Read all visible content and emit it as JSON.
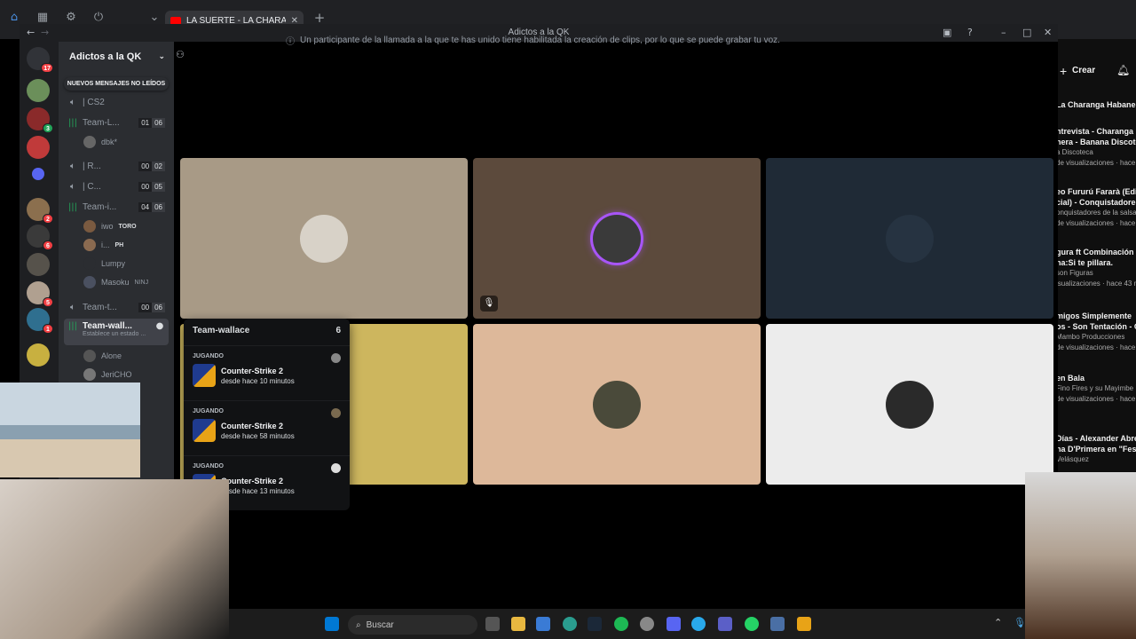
{
  "browser": {
    "tab_title": "LA SUERTE - LA CHARANGA H",
    "tab_close": "✕",
    "new_tab": "+"
  },
  "discord": {
    "window_title": "Adictos a la QK",
    "notice": "Un participante de la llamada a la que te has unido tiene habilitada la creación de clips, por lo que se puede grabar tu voz.",
    "home_badge": "17",
    "server_badges": [
      "3",
      "2",
      "6",
      "5",
      "1"
    ],
    "guild_name": "Adictos a la QK",
    "new_messages": "NUEVOS MENSAJES NO LEÍDOS",
    "channels": [
      {
        "name": "| CS2",
        "a": "",
        "b": ""
      },
      {
        "name": "Team-L...",
        "a": "01",
        "b": "06"
      },
      {
        "name": "| R...",
        "a": "00",
        "b": "02"
      },
      {
        "name": "| C...",
        "a": "00",
        "b": "05"
      },
      {
        "name": "Team-i...",
        "a": "04",
        "b": "06"
      },
      {
        "name": "Team-t...",
        "a": "00",
        "b": "06"
      },
      {
        "name": "Team-wall...",
        "a": "",
        "b": ""
      }
    ],
    "active_channel_status": "Establece un estado ...",
    "users": {
      "dbk": "dbk*",
      "iwo": "iwo",
      "toro": "TORO",
      "i": "i...",
      "ph": "PH",
      "lumpy": "Lumpy",
      "masoku": "Masoku",
      "ninj": "NINJ",
      "alone": "Alone",
      "jericho": "JeriCHO"
    },
    "popover": {
      "title": "Team-wallace",
      "count": "6",
      "activities": [
        {
          "label": "JUGANDO",
          "game": "Counter-Strike 2",
          "time": "desde hace 10 minutos"
        },
        {
          "label": "JUGANDO",
          "game": "Counter-Strike 2",
          "time": "desde hace 58 minutos"
        },
        {
          "label": "JUGANDO",
          "game": "Counter-Strike 2",
          "time": "desde hace 13 minutos"
        }
      ]
    },
    "tile_colors": [
      "#a89a86",
      "#5c4a3c",
      "#1f2a36",
      "#cdb65e",
      "#ddb89a",
      "#ececec"
    ]
  },
  "youtube": {
    "create": "Crear",
    "channel_header": "La Charanga Habanera",
    "items": [
      {
        "a": "ntrevista - Charanga",
        "b": "nera - Banana Discote",
        "c": "a Discoteca",
        "d": "de visualizaciones · hace 1"
      },
      {
        "a": "eo Fururú Fararà (Edic",
        "b": "cial) - Conquistadore",
        "c": "onquistadores de la salsa",
        "d": "de visualizaciones · hace 1"
      },
      {
        "a": "gura ft Combinación d",
        "b": "na:Si te pillara.",
        "c": "son Figuras",
        "d": "isualizaciones · hace 43 m"
      },
      {
        "a": "migos Simplemente",
        "b": "os - Son Tentación - C",
        "c": "Mambo Producciones",
        "d": "de visualizaciones · hace"
      },
      {
        "a": "en Bala",
        "b": "",
        "c": "Fino Fires y su Mayimbe",
        "d": "de visualizaciones · hace"
      },
      {
        "a": "Días - Alexander Abre",
        "b": "na D'Primera en \"Fest",
        "c": "Velásquez",
        "d": ""
      }
    ]
  },
  "taskbar": {
    "search_placeholder": "Buscar"
  }
}
